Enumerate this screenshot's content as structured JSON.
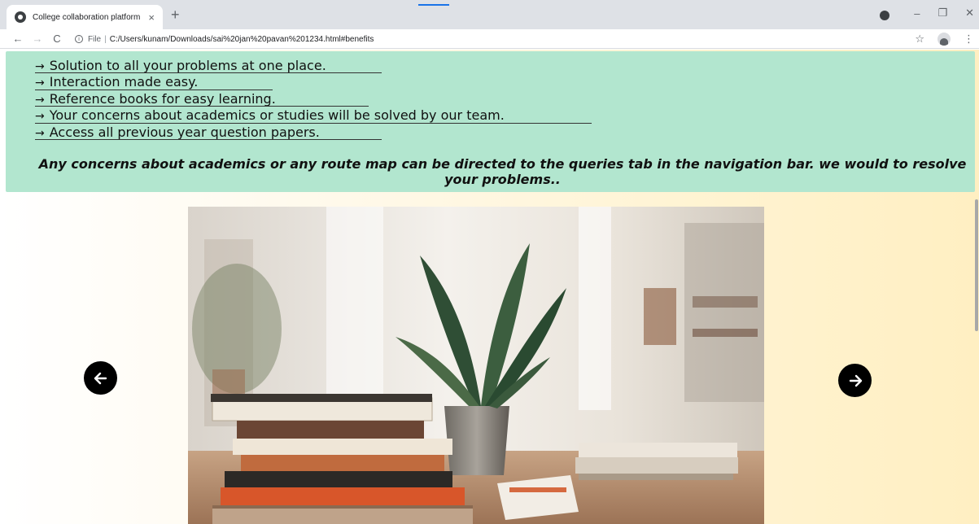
{
  "browser": {
    "tab_title": "College collaboration platform",
    "tab_close": "×",
    "new_tab": "+",
    "url_file_label": "File",
    "url_separator": "|",
    "url": "C:/Users/kunam/Downloads/sai%20jan%20pavan%201234.html#benefits",
    "win_minimize": "–",
    "win_restore": "❐",
    "win_close": "✕",
    "nav_back": "←",
    "nav_forward": "→",
    "nav_reload": "C",
    "star": "☆",
    "menu": "⋮"
  },
  "benefits": {
    "items": [
      {
        "text": "Solution to all your problems at one place."
      },
      {
        "text": "Interaction made easy."
      },
      {
        "text": "Reference books for easy learning."
      },
      {
        "text": "Your concerns about academics or studies will be solved by our team."
      },
      {
        "text": "Access all previous year question papers."
      }
    ],
    "arrow": "→",
    "note": "Any concerns about academics or any route map can be directed to the queries tab in the navigation bar. we would to resolve your problems..",
    "panel_color": "#b2e6cf"
  },
  "carousel": {
    "prev_icon": "arrow-left-icon",
    "next_icon": "arrow-right-icon"
  }
}
